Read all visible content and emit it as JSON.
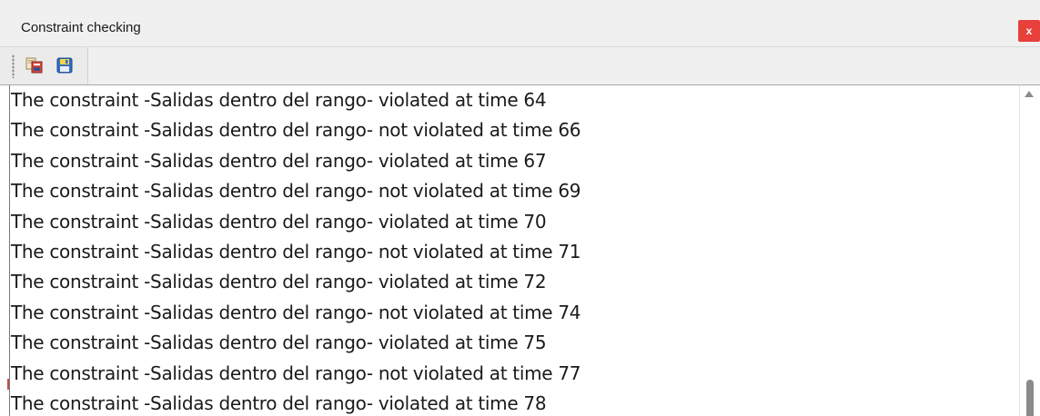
{
  "window": {
    "title": "Constraint checking",
    "close_label": "x"
  },
  "toolbar": {
    "buttons": [
      {
        "icon": "copy-icon"
      },
      {
        "icon": "save-icon"
      }
    ]
  },
  "log": {
    "lines": [
      "The constraint -Salidas dentro del rango- violated at time 64",
      "The constraint -Salidas dentro del rango- not violated at time 66",
      "The constraint -Salidas dentro del rango- violated at time 67",
      "The constraint -Salidas dentro del rango- not violated at time 69",
      "The constraint -Salidas dentro del rango- violated at time 70",
      "The constraint -Salidas dentro del rango- not violated at time 71",
      "The constraint -Salidas dentro del rango- violated at time 72",
      "The constraint -Salidas dentro del rango- not violated at time 74",
      "The constraint -Salidas dentro del rango- violated at time 75",
      "The constraint -Salidas dentro del rango- not violated at time 77",
      "The constraint -Salidas dentro del rango- violated at time 78"
    ]
  },
  "colors": {
    "close_button": "#e8403a",
    "chrome": "#f0f0f0",
    "text": "#1a1a1a"
  }
}
